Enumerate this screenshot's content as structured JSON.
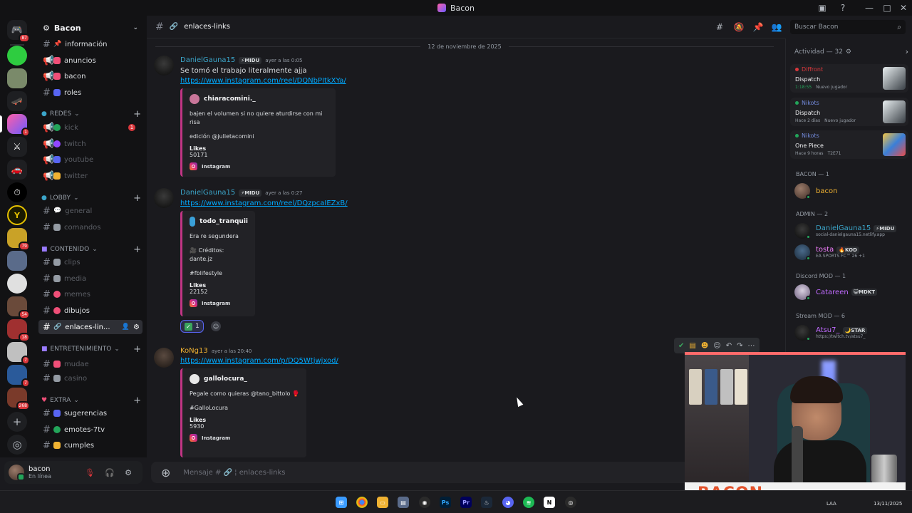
{
  "window": {
    "title": "Bacon"
  },
  "server": {
    "name": "Bacon"
  },
  "rail_badges": [
    "87",
    "1",
    "79",
    "54",
    "18",
    "7",
    "7",
    "268"
  ],
  "channels_top": [
    {
      "name": "información",
      "color": "#f04f78"
    },
    {
      "name": "anuncios",
      "color": "#f04f78"
    },
    {
      "name": "bacon",
      "color": "#f04f78"
    },
    {
      "name": "roles",
      "color": "#5865f2"
    }
  ],
  "categories": {
    "redes": "REDES",
    "lobby": "LOBBY",
    "contenido": "CONTENIDO",
    "entretenimiento": "ENTRETENIMIENTO",
    "extra": "EXTRA"
  },
  "channels_redes": [
    {
      "name": "kick",
      "color": "#23a55a",
      "badge": "1"
    },
    {
      "name": "twitch",
      "color": "#9146ff"
    },
    {
      "name": "youtube",
      "color": "#5865f2"
    },
    {
      "name": "twitter",
      "color": "#f0b232"
    }
  ],
  "channels_lobby": [
    {
      "name": "general",
      "color": "#dbdee1"
    },
    {
      "name": "comandos",
      "color": "#949ba4"
    }
  ],
  "channels_contenido": [
    {
      "name": "clips",
      "color": "#949ba4"
    },
    {
      "name": "media",
      "color": "#949ba4"
    },
    {
      "name": "memes",
      "color": "#f04f78"
    },
    {
      "name": "dibujos",
      "color": "#f04f78"
    },
    {
      "name": "enlaces-lin...",
      "color": "#949ba4"
    }
  ],
  "channels_entretenimiento": [
    {
      "name": "mudae",
      "color": "#f04f78"
    },
    {
      "name": "casino",
      "color": "#949ba4"
    }
  ],
  "channels_extra": [
    {
      "name": "sugerencias",
      "color": "#5865f2"
    },
    {
      "name": "emotes-7tv",
      "color": "#23a55a"
    },
    {
      "name": "cumples",
      "color": "#f0b232"
    }
  ],
  "user": {
    "name": "bacon",
    "status": "En línea"
  },
  "channel_header": {
    "name": "enlaces-links"
  },
  "search": {
    "placeholder": "Buscar Bacon"
  },
  "date_divider": "12 de noviembre de 2025",
  "messages": [
    {
      "author": "DanielGauna15",
      "author_color": "#3ba5c9",
      "tag": "MIDU",
      "time": "ayer a las 0:05",
      "text": "Se tomó el trabajo literalmente ajja",
      "link": "https://www.instagram.com/reel/DQNbPItkXYa/",
      "embed": {
        "author": "chiaracomini._",
        "lines": [
          "bajen el volumen si no quiere aturdirse con mi risa",
          "",
          "edición @julietacomini"
        ],
        "field_name": "Likes",
        "field_value": "50171",
        "footer": "Instagram"
      }
    },
    {
      "author": "DanielGauna15",
      "author_color": "#3ba5c9",
      "tag": "MIDU",
      "time": "ayer a las 0:27",
      "link": "https://www.instagram.com/reel/DQzpcaIEZxB/",
      "embed": {
        "author": "todo_tranquii",
        "lines": [
          "Era re segundera",
          "",
          "🎥 Créditos: dante.jz",
          "",
          "#fblifestyle"
        ],
        "field_name": "Likes",
        "field_value": "22152",
        "footer": "Instagram"
      },
      "reaction_count": "1"
    },
    {
      "author": "KoNg13",
      "author_color": "#f0b232",
      "time": "ayer a las 20:40",
      "link": "https://www.instagram.com/p/DQ5Wtjwjxod/",
      "embed": {
        "author": "gallolocura_",
        "lines": [
          "Pegale como quieras @tano_bittolo 🥊",
          "",
          "#GalloLocura"
        ],
        "field_name": "Likes",
        "field_value": "5930",
        "footer": "Instagram"
      }
    }
  ],
  "composer": {
    "placeholder": "Mensaje # 🔗 ¦ enlaces-links"
  },
  "activity": {
    "header": "Actividad — 32",
    "items": [
      {
        "user": "Diffront",
        "user_color": "#da373c",
        "game": "Dispatch",
        "meta1": "1:18:55",
        "meta2": "Nuevo jugador"
      },
      {
        "user": "Nikots",
        "user_color": "#7289da",
        "game": "Dispatch",
        "meta1": "Hace 2 días",
        "meta2": "Nuevo jugador"
      },
      {
        "user": "Nikots",
        "user_color": "#7289da",
        "game": "One Piece",
        "meta1": "Hace 9 horas",
        "meta2": "T2E71"
      }
    ]
  },
  "members": {
    "bacon_section": "BACON — 1",
    "bacon_member": "bacon",
    "admin_section": "ADMIN — 2",
    "admins": [
      {
        "name": "DanielGauna15",
        "color": "#3ba5c9",
        "tag": "MIDU",
        "sub": "social-danielgauna15.netlify.app"
      },
      {
        "name": "tosta",
        "color": "#f47fff",
        "tag": "KOD",
        "sub": "EA SPORTS FC™ 26 +1"
      }
    ],
    "mod_section": "Discord MOD — 1",
    "mods": [
      {
        "name": "Catareen",
        "color": "#c06bff",
        "tag": "MDKT"
      }
    ],
    "stream_section": "Stream MOD — 6",
    "stream_mods": [
      {
        "name": "Atsu7_",
        "color": "#c06bff",
        "tag": "STAR",
        "sub": "https://twitch.tv/atsu7_"
      }
    ]
  },
  "webcam": {
    "banner": "BACON"
  },
  "taskbar": {
    "lang": "LAA",
    "date": "13/11/2025"
  }
}
